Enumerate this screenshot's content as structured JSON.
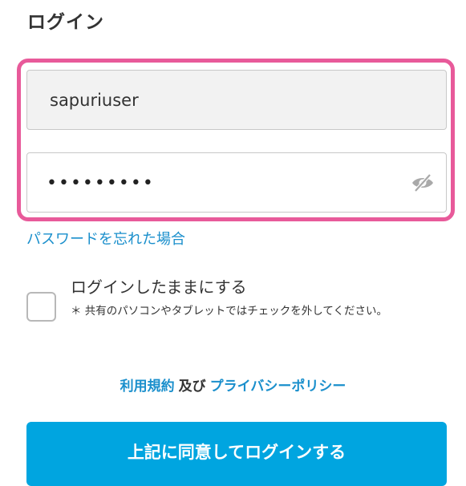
{
  "header": {
    "title": "ログイン"
  },
  "form": {
    "username_value": "sapuriuser",
    "password_masked": "•••••••••",
    "highlight_color": "#e85a9a",
    "toggle_icon": "eye-slash-icon"
  },
  "links": {
    "forgot_password": "パスワードを忘れた場合"
  },
  "keep_login": {
    "label": "ログインしたままにする",
    "checked": false,
    "note": "＊ 共有のパソコンやタブレットではチェックを外してください。"
  },
  "terms": {
    "terms_link": "利用規約",
    "conjunction": "及び",
    "privacy_link": "プライバシーポリシー"
  },
  "submit": {
    "label": "上記に同意してログインする",
    "color": "#00a5e0"
  }
}
